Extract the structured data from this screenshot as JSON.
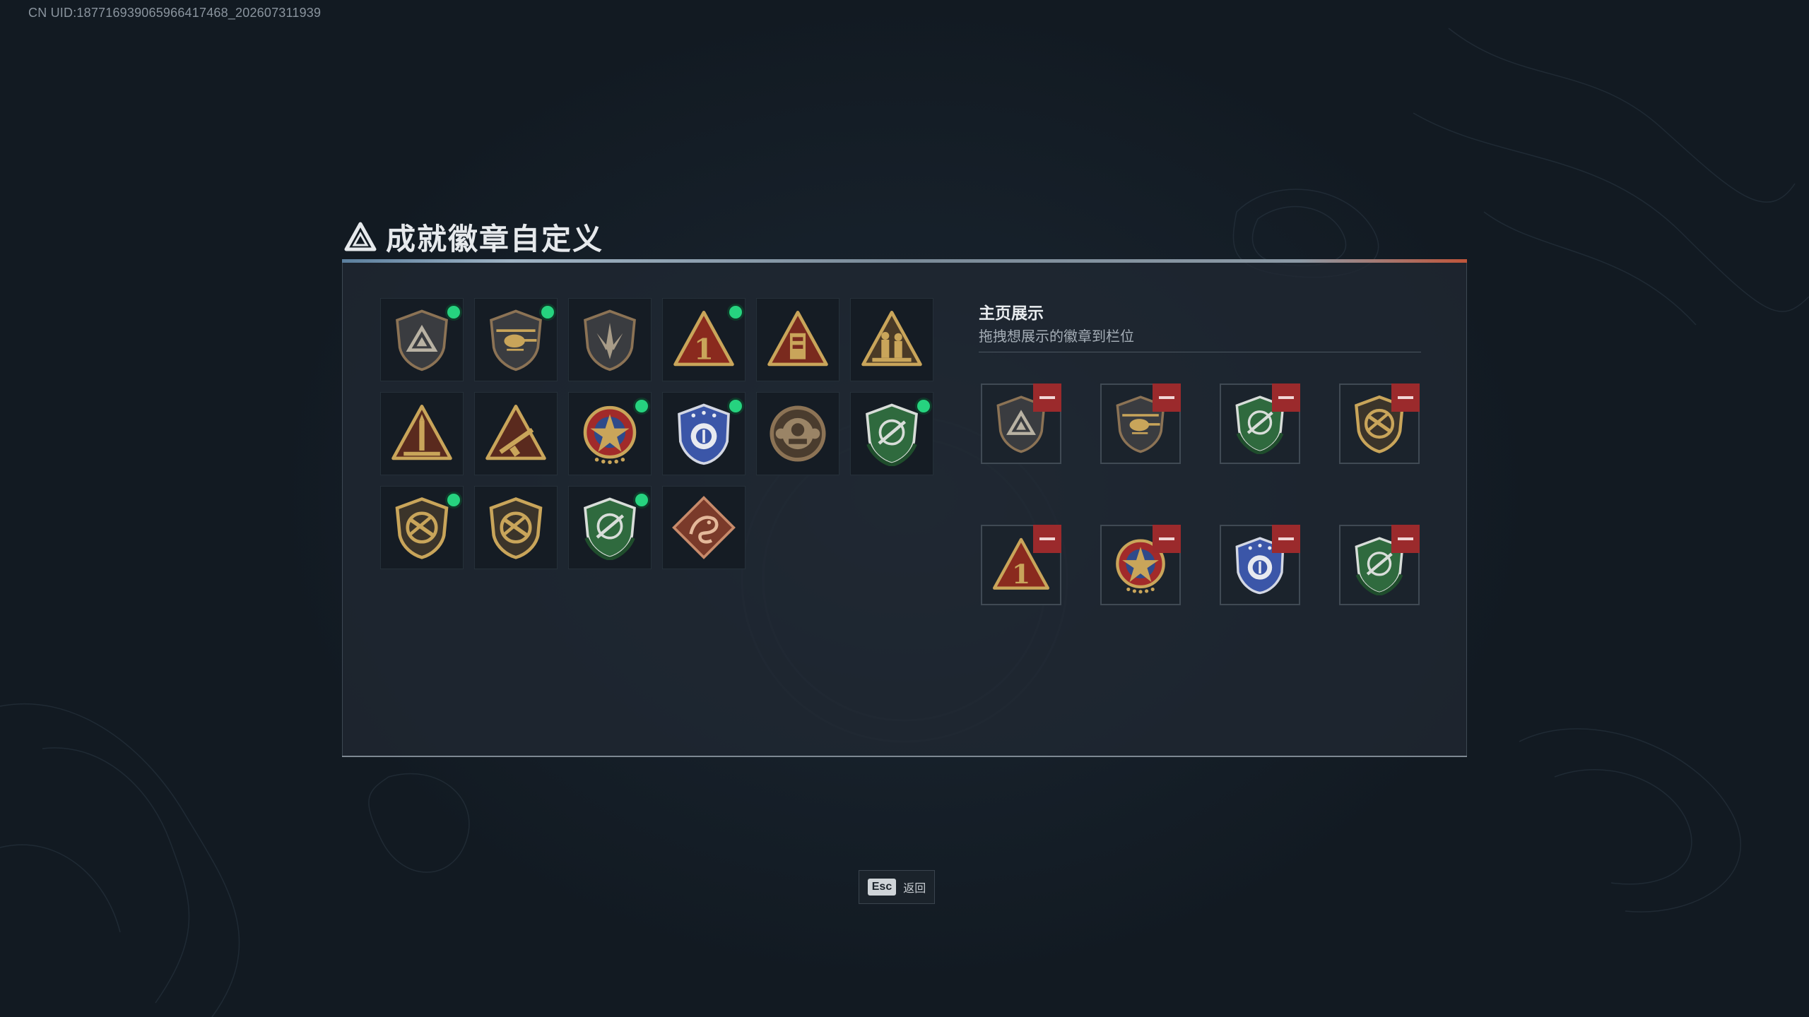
{
  "uid_text": "CN UID:1877169390659664174​68_202607311939",
  "dialog": {
    "title": "成就徽章自定义",
    "showcase_title": "主页展示",
    "showcase_subtitle": "拖拽想展示的徽章到栏位"
  },
  "inventory": [
    {
      "icon": "shield-triangle-badge-icon",
      "new": true
    },
    {
      "icon": "shield-helicopter-badge-icon",
      "new": true
    },
    {
      "icon": "shield-blades-badge-icon",
      "new": false
    },
    {
      "icon": "triangle-number-one-badge-icon",
      "new": true
    },
    {
      "icon": "triangle-tower-badge-icon",
      "new": false
    },
    {
      "icon": "triangle-soldiers-badge-icon",
      "new": false
    },
    {
      "icon": "triangle-rocket-badge-icon",
      "new": false
    },
    {
      "icon": "triangle-rifle-badge-icon",
      "new": false
    },
    {
      "icon": "star-medal-badge-icon",
      "new": true
    },
    {
      "icon": "blue-police-badge-icon",
      "new": true
    },
    {
      "icon": "round-bronze-emblem-icon",
      "new": false
    },
    {
      "icon": "green-shield-crosshair-badge-icon",
      "new": true
    },
    {
      "icon": "gold-shield-no-gun-badge-icon",
      "new": true
    },
    {
      "icon": "gold-shield-no-gun-badge-icon",
      "new": false
    },
    {
      "icon": "green-shield-crosshair-badge-icon",
      "new": true
    },
    {
      "icon": "dragon-diamond-badge-icon",
      "new": false
    }
  ],
  "showcase": [
    {
      "icon": "shield-triangle-badge-icon"
    },
    {
      "icon": "shield-helicopter-badge-icon"
    },
    {
      "icon": "green-shield-crosshair-badge-icon"
    },
    {
      "icon": "gold-shield-no-gun-badge-icon"
    },
    {
      "icon": "triangle-number-one-badge-icon"
    },
    {
      "icon": "star-medal-badge-icon"
    },
    {
      "icon": "blue-police-badge-icon"
    },
    {
      "icon": "green-shield-crosshair-badge-icon"
    }
  ],
  "esc": {
    "key": "Esc",
    "label": "返回"
  },
  "colors": {
    "new_indicator": "#26d37f",
    "remove_button": "#9b2a2c",
    "accent_line_end": "#c0553a"
  }
}
